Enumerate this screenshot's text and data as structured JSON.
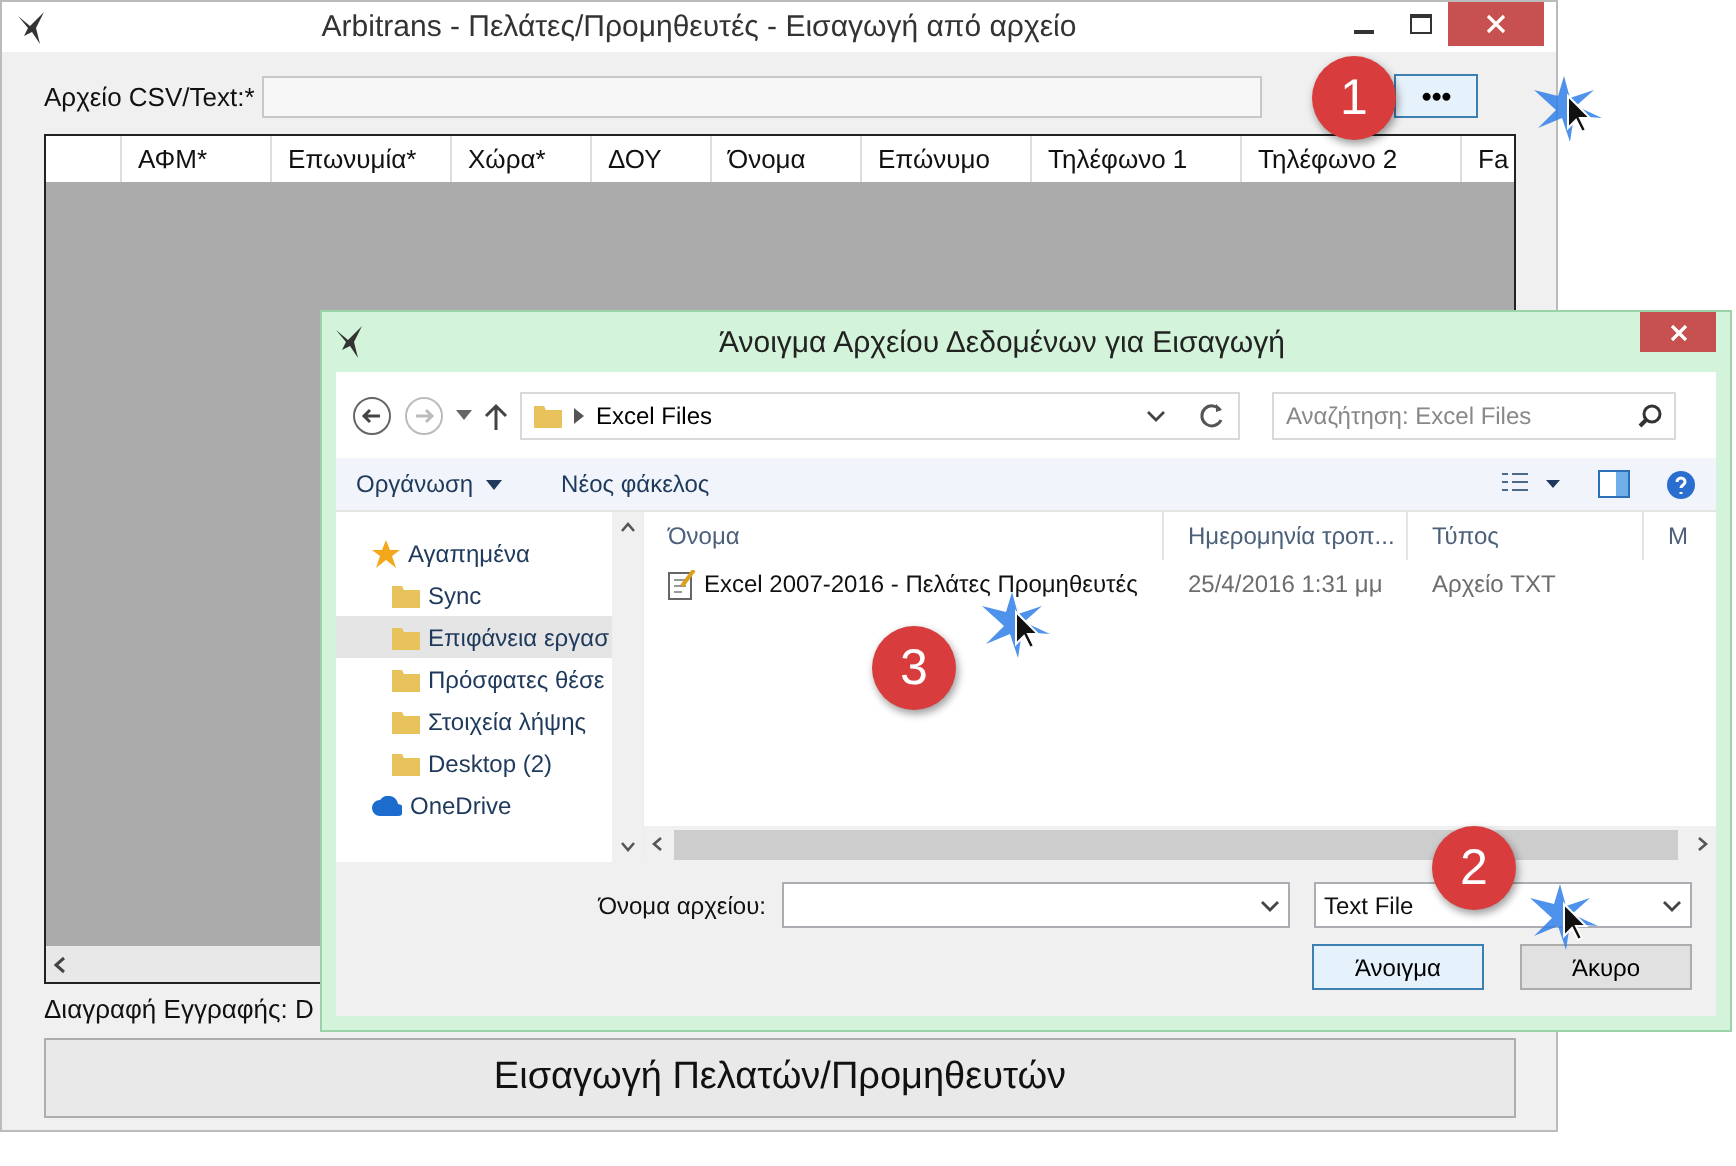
{
  "window": {
    "title": "Arbitrans - Πελάτες/Προμηθευτές - Εισαγωγή από αρχείο"
  },
  "file_field": {
    "label": "Αρχείο CSV/Text:*",
    "browse": "•••"
  },
  "grid": {
    "columns": [
      "ΑΦΜ*",
      "Επωνυμία*",
      "Χώρα*",
      "ΔΟΥ",
      "Όνομα",
      "Επώνυμο",
      "Τηλέφωνο 1",
      "Τηλέφωνο 2",
      "Fa"
    ]
  },
  "status": "Διαγραφή Εγγραφής: D",
  "import_button": "Εισαγωγή Πελατών/Προμηθευτών",
  "dialog": {
    "title": "Άνοιγμα Αρχείου Δεδομένων για Εισαγωγή",
    "path": "Excel Files",
    "search_placeholder": "Αναζήτηση: Excel Files",
    "commands": [
      "Οργάνωση",
      "Νέος φάκελος"
    ],
    "nav": [
      {
        "label": "Αγαπημένα",
        "selected": false,
        "children": [
          {
            "label": "Sync",
            "selected": false
          },
          {
            "label": "Επιφάνεια εργασ",
            "selected": true
          },
          {
            "label": "Πρόσφατες θέσε",
            "selected": false
          },
          {
            "label": "Στοιχεία λήψης",
            "selected": false
          },
          {
            "label": "Desktop (2)",
            "selected": false
          }
        ]
      },
      {
        "label": "OneDrive",
        "selected": false
      }
    ],
    "columns": [
      "Όνομα",
      "Ημερομηνία τροπ...",
      "Τύπος",
      "Μ"
    ],
    "files": [
      {
        "name": "Excel 2007-2016 - Πελάτες Προμηθευτές",
        "date": "25/4/2016 1:31 μμ",
        "type": "Αρχείο TXT"
      }
    ],
    "filename_label": "Όνομα αρχείου:",
    "filter": "Text File",
    "buttons": [
      "Άνοιγμα",
      "Άκυρο"
    ]
  },
  "steps": [
    "1",
    "2",
    "3"
  ]
}
